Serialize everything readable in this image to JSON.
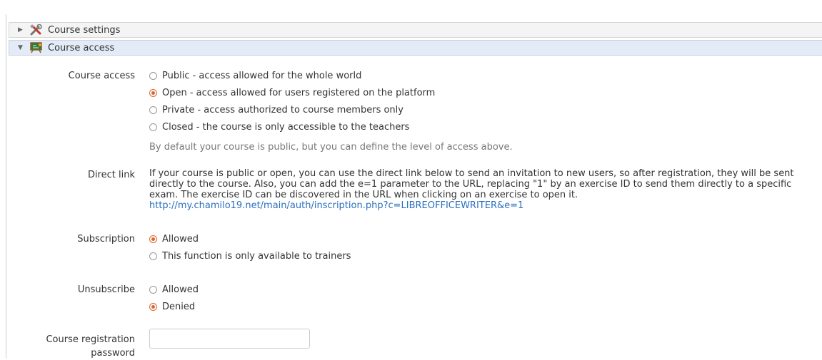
{
  "panels": {
    "settings": {
      "label": "Course settings",
      "icon": "tools-icon",
      "expanded": false
    },
    "access": {
      "label": "Course access",
      "icon": "blackboard-icon",
      "expanded": true
    }
  },
  "course_access": {
    "label": "Course access",
    "options": [
      {
        "label": "Public - access allowed for the whole world",
        "checked": false
      },
      {
        "label": "Open - access allowed for users registered on the platform",
        "checked": true
      },
      {
        "label": "Private - access authorized to course members only",
        "checked": false
      },
      {
        "label": "Closed - the course is only accessible to the teachers",
        "checked": false
      }
    ],
    "help": "By default your course is public, but you can define the level of access above."
  },
  "direct_link": {
    "label": "Direct link",
    "text": "If your course is public or open, you can use the direct link below to send an invitation to new users, so after registration, they will be sent directly to the course. Also, you can add the e=1 parameter to the URL, replacing \"1\" by an exercise ID to send them directly to a specific exam. The exercise ID can be discovered in the URL when clicking on an exercise to open it.",
    "url": "http://my.chamilo19.net/main/auth/inscription.php?c=LIBREOFFICEWRITER&e=1"
  },
  "subscription": {
    "label": "Subscription",
    "options": [
      {
        "label": "Allowed",
        "checked": true
      },
      {
        "label": "This function is only available to trainers",
        "checked": false
      }
    ]
  },
  "unsubscribe": {
    "label": "Unsubscribe",
    "options": [
      {
        "label": "Allowed",
        "checked": false
      },
      {
        "label": "Denied",
        "checked": true
      }
    ]
  },
  "registration_password": {
    "label_line1": "Course registration",
    "label_line2": "password",
    "value": ""
  },
  "colors": {
    "accent_radio": "#e0662f",
    "link": "#2a6fc0",
    "active_panel": "#e3ebf6"
  }
}
